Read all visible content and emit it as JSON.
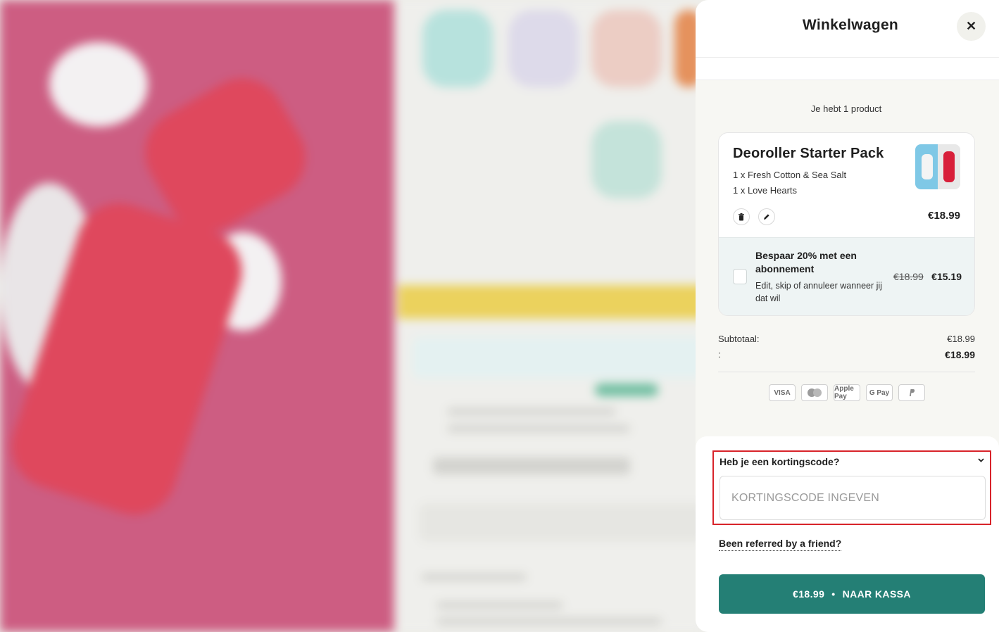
{
  "cart": {
    "title": "Winkelwagen",
    "close_symbol": "✕",
    "count_text": "Je hebt 1 product",
    "product": {
      "name": "Deoroller Starter Pack",
      "lines": [
        "1 x Fresh Cotton & Sea Salt",
        "1 x Love Hearts"
      ],
      "price": "€18.99"
    },
    "subscription": {
      "title": "Bespaar 20% met een abonnement",
      "description": "Edit, skip of annuleer wanneer jij dat wil",
      "old_price": "€18.99",
      "new_price": "€15.19"
    },
    "totals": {
      "subtotal_label": "Subtotaal:",
      "subtotal_value": "€18.99",
      "total_label": ":",
      "total_value": "€18.99"
    },
    "payment_methods": [
      "VISA",
      "Mastercard",
      "Apple Pay",
      "G Pay",
      "PayPal"
    ],
    "coupon": {
      "title": "Heb je een kortingscode?",
      "placeholder": "KORTINGSCODE INGEVEN"
    },
    "referral_link": "Been referred by a friend?",
    "checkout": {
      "price": "€18.99",
      "separator": "•",
      "label": "NAAR KASSA"
    }
  },
  "colors": {
    "accent": "#247f75",
    "highlight_border": "#d8232a",
    "background_pink": "#c23a67"
  }
}
